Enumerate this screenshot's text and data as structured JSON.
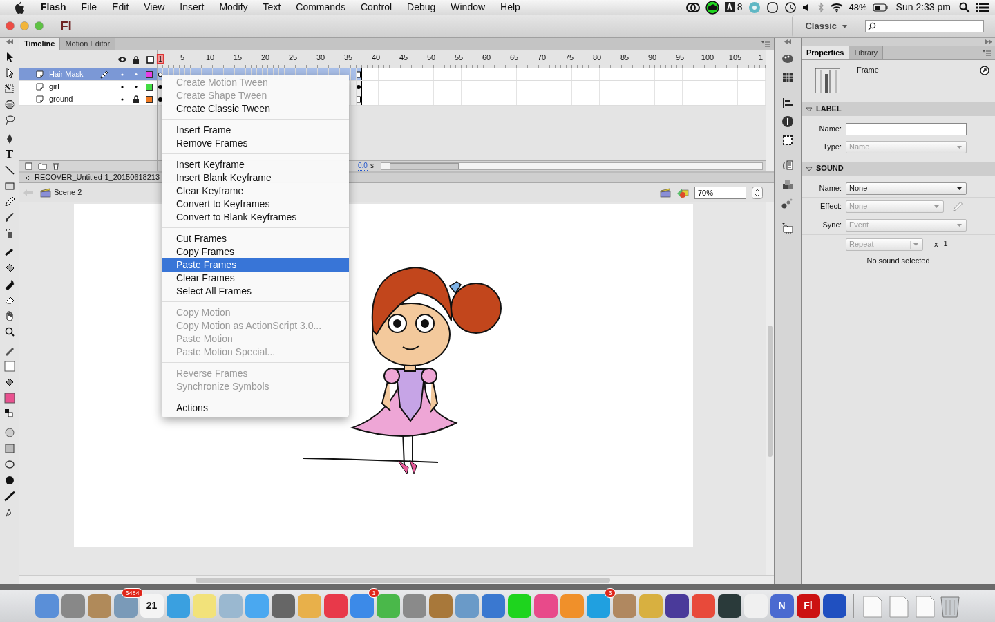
{
  "menubar": {
    "menus": [
      "Flash",
      "File",
      "Edit",
      "View",
      "Insert",
      "Modify",
      "Text",
      "Commands",
      "Control",
      "Debug",
      "Window",
      "Help"
    ],
    "adobe_count": "8",
    "battery": "48%",
    "clock": "Sun 2:33 pm"
  },
  "window": {
    "logo": "Fl",
    "workspace": "Classic"
  },
  "toolbar": {
    "text_tool": "T"
  },
  "timeline": {
    "tabs": [
      {
        "label": "Timeline",
        "selected": true
      },
      {
        "label": "Motion Editor",
        "selected": false
      }
    ],
    "ruler": [
      "1",
      "5",
      "10",
      "15",
      "20",
      "25",
      "30",
      "35",
      "40",
      "45",
      "50",
      "55",
      "60",
      "65",
      "70",
      "75",
      "80",
      "85",
      "90",
      "95",
      "100",
      "105",
      "1"
    ],
    "layers": [
      {
        "name": "Hair Mask",
        "selected": true,
        "editing": true,
        "visible": true,
        "locked": false,
        "color": "#e63ee6",
        "start_key_filled": false,
        "end_key_filled": false
      },
      {
        "name": "girl",
        "selected": false,
        "editing": false,
        "visible": true,
        "locked": false,
        "color": "#44dd44",
        "start_key_filled": true,
        "end_key_filled": true
      },
      {
        "name": "ground",
        "selected": false,
        "editing": false,
        "visible": true,
        "locked": true,
        "color": "#f07a22",
        "start_key_filled": true,
        "end_key_filled": false
      }
    ],
    "time": "0.0",
    "time_unit": "s"
  },
  "document": {
    "tab": "RECOVER_Untitled-1_20150618213",
    "scene": "Scene 2",
    "zoom": "70%"
  },
  "context_menu": {
    "groups": [
      [
        {
          "label": "Create Motion Tween",
          "disabled": true,
          "selected": false
        },
        {
          "label": "Create Shape Tween",
          "disabled": true,
          "selected": false
        },
        {
          "label": "Create Classic Tween",
          "disabled": false,
          "selected": false
        }
      ],
      [
        {
          "label": "Insert Frame",
          "disabled": false,
          "selected": false
        },
        {
          "label": "Remove Frames",
          "disabled": false,
          "selected": false
        }
      ],
      [
        {
          "label": "Insert Keyframe",
          "disabled": false,
          "selected": false
        },
        {
          "label": "Insert Blank Keyframe",
          "disabled": false,
          "selected": false
        },
        {
          "label": "Clear Keyframe",
          "disabled": false,
          "selected": false
        },
        {
          "label": "Convert to Keyframes",
          "disabled": false,
          "selected": false
        },
        {
          "label": "Convert to Blank Keyframes",
          "disabled": false,
          "selected": false
        }
      ],
      [
        {
          "label": "Cut Frames",
          "disabled": false,
          "selected": false
        },
        {
          "label": "Copy Frames",
          "disabled": false,
          "selected": false
        },
        {
          "label": "Paste Frames",
          "disabled": false,
          "selected": true
        },
        {
          "label": "Clear Frames",
          "disabled": false,
          "selected": false
        },
        {
          "label": "Select All Frames",
          "disabled": false,
          "selected": false
        }
      ],
      [
        {
          "label": "Copy Motion",
          "disabled": true,
          "selected": false
        },
        {
          "label": "Copy Motion as ActionScript 3.0...",
          "disabled": true,
          "selected": false
        },
        {
          "label": "Paste Motion",
          "disabled": true,
          "selected": false
        },
        {
          "label": "Paste Motion Special...",
          "disabled": true,
          "selected": false
        }
      ],
      [
        {
          "label": "Reverse Frames",
          "disabled": true,
          "selected": false
        },
        {
          "label": "Synchronize Symbols",
          "disabled": true,
          "selected": false
        }
      ],
      [
        {
          "label": "Actions",
          "disabled": false,
          "selected": false
        }
      ]
    ]
  },
  "properties": {
    "tabs": [
      {
        "label": "Properties",
        "selected": true
      },
      {
        "label": "Library",
        "selected": false
      }
    ],
    "title": "Frame",
    "sections": [
      {
        "title": "LABEL",
        "expanded": true,
        "fields": [
          {
            "kind": "text",
            "label": "Name:"
          },
          {
            "kind": "select",
            "label": "Type:",
            "value": "Name",
            "disabled": true
          }
        ]
      },
      {
        "title": "SOUND",
        "expanded": true,
        "fields": [
          {
            "kind": "select",
            "label": "Name:",
            "value": "None",
            "disabled": false
          },
          {
            "kind": "select",
            "label": "Effect:",
            "value": "None",
            "disabled": true,
            "edit": true
          },
          {
            "kind": "select",
            "label": "Sync:",
            "value": "Event",
            "disabled": true
          },
          {
            "kind": "repeat",
            "value": "Repeat",
            "disabled": true,
            "times": "x",
            "count": "1"
          }
        ],
        "note": "No sound selected"
      }
    ]
  },
  "dock": [
    {
      "kind": "app"
    },
    {
      "kind": "app"
    },
    {
      "kind": "app"
    },
    {
      "kind": "app",
      "badge": "6484"
    },
    {
      "kind": "app",
      "label": "21"
    },
    {
      "kind": "app"
    },
    {
      "kind": "app"
    },
    {
      "kind": "app"
    },
    {
      "kind": "app"
    },
    {
      "kind": "app"
    },
    {
      "kind": "app"
    },
    {
      "kind": "app"
    },
    {
      "kind": "app",
      "badge": "1"
    },
    {
      "kind": "app"
    },
    {
      "kind": "app"
    },
    {
      "kind": "app"
    },
    {
      "kind": "app"
    },
    {
      "kind": "app"
    },
    {
      "kind": "app"
    },
    {
      "kind": "app"
    },
    {
      "kind": "app"
    },
    {
      "kind": "app",
      "badge": "3"
    },
    {
      "kind": "app"
    },
    {
      "kind": "app"
    },
    {
      "kind": "app"
    },
    {
      "kind": "app"
    },
    {
      "kind": "app"
    },
    {
      "kind": "app"
    },
    {
      "kind": "app",
      "label": "N"
    },
    {
      "kind": "app",
      "label": "Fl"
    },
    {
      "kind": "app"
    },
    {
      "kind": "separator"
    },
    {
      "kind": "document"
    },
    {
      "kind": "document"
    },
    {
      "kind": "document"
    },
    {
      "kind": "trash"
    }
  ]
}
